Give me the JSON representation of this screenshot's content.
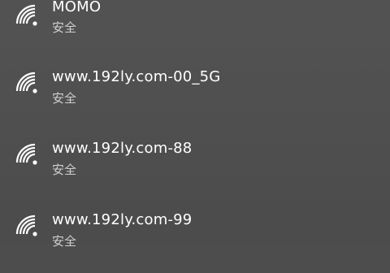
{
  "networks": [
    {
      "ssid": "MOMO",
      "status": "安全",
      "icon": "wifi-signal-icon"
    },
    {
      "ssid": "www.192ly.com-00_5G",
      "status": "安全",
      "icon": "wifi-signal-icon"
    },
    {
      "ssid": "www.192ly.com-88",
      "status": "安全",
      "icon": "wifi-signal-icon"
    },
    {
      "ssid": "www.192ly.com-99",
      "status": "安全",
      "icon": "wifi-signal-icon"
    }
  ],
  "colors": {
    "background": "#4d4d4d",
    "text_primary": "#ffffff",
    "text_secondary": "#cfcfcf"
  }
}
